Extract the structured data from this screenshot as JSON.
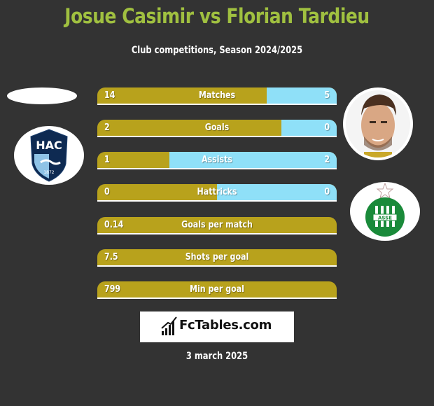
{
  "header": {
    "title": "Josue Casimir vs Florian Tardieu",
    "subtitle": "Club competitions, Season 2024/2025"
  },
  "colors": {
    "left_player": "#b8a21c",
    "right_player": "#8fe0f8",
    "title": "#a0c040",
    "background": "#333333"
  },
  "players": {
    "left": {
      "name": "Josue Casimir",
      "club": "Le Havre AC",
      "club_badge_text": "HAC",
      "club_badge_year": "1872"
    },
    "right": {
      "name": "Florian Tardieu",
      "club": "AS Saint-Etienne",
      "club_badge_text": "ASSE"
    }
  },
  "stats": [
    {
      "label": "Matches",
      "left": "14",
      "right": "5",
      "left_share": 0.707
    },
    {
      "label": "Goals",
      "left": "2",
      "right": "0",
      "left_share": 0.77
    },
    {
      "label": "Assists",
      "left": "1",
      "right": "2",
      "left_share": 0.3
    },
    {
      "label": "Hattricks",
      "left": "0",
      "right": "0",
      "left_share": 0.5
    },
    {
      "label": "Goals per match",
      "left": "0.14",
      "right": "",
      "left_share": 1
    },
    {
      "label": "Shots per goal",
      "left": "7.5",
      "right": "",
      "left_share": 1
    },
    {
      "label": "Min per goal",
      "left": "799",
      "right": "",
      "left_share": 1
    }
  ],
  "footer": {
    "brand": "FcTables.com",
    "brand_icon": "bar-chart-icon",
    "date": "3 march 2025"
  }
}
